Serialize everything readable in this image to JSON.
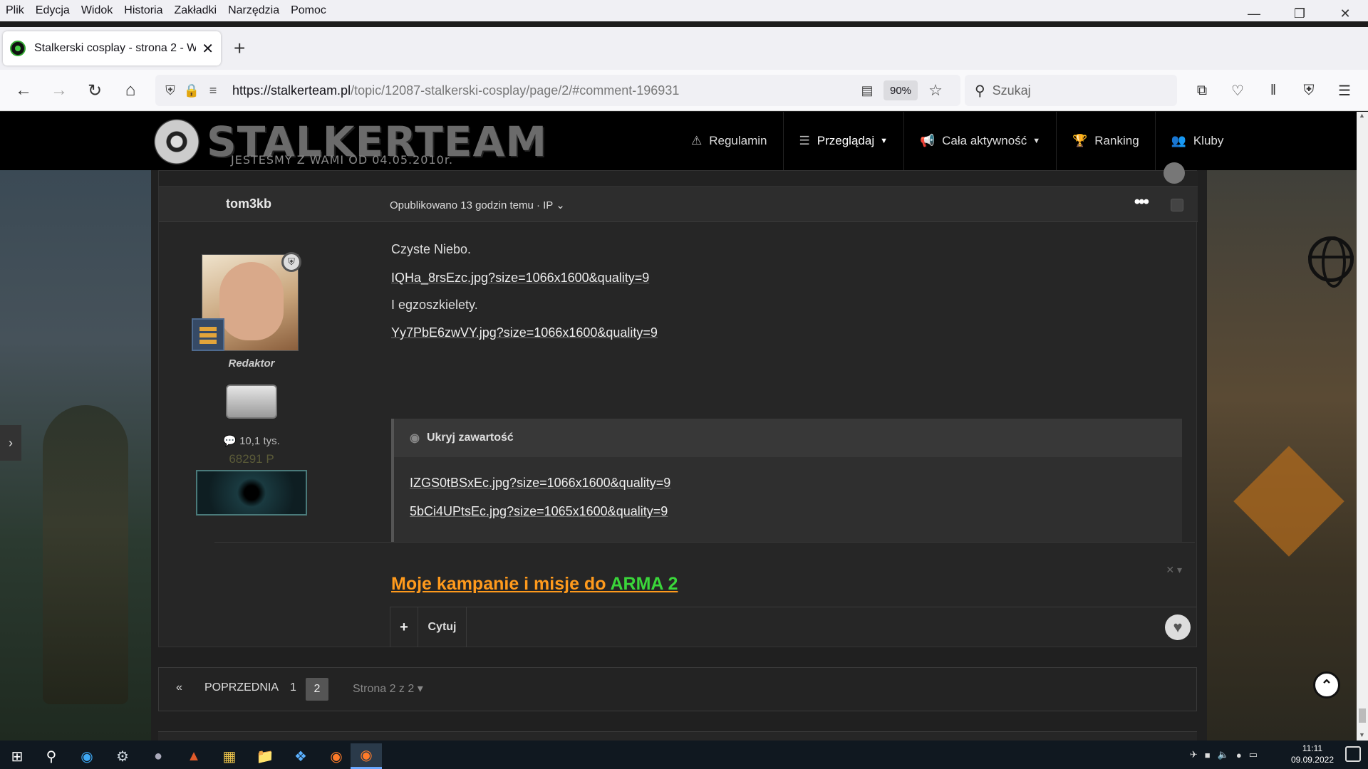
{
  "browser": {
    "menu": [
      "Plik",
      "Edycja",
      "Widok",
      "Historia",
      "Zakładki",
      "Narzędzia",
      "Pomoc"
    ],
    "tab_title": "Stalkerski cosplay - strona 2 - W",
    "url_host": "https://stalkerteam.pl",
    "url_path": "/topic/12087-stalkerski-cosplay/page/2/#comment-196931",
    "zoom": "90%",
    "search_placeholder": "Szukaj"
  },
  "site": {
    "logo_title": "STALKERTEAM",
    "logo_tagline": "JESTEŚMY Z WAMI OD 04.05.2010r.",
    "nav": [
      {
        "label": "Regulamin",
        "icon": "warning-icon"
      },
      {
        "label": "Przeglądaj",
        "icon": "list-icon",
        "dropdown": true
      },
      {
        "label": "Cała aktywność",
        "icon": "megaphone-icon",
        "dropdown": true
      },
      {
        "label": "Ranking",
        "icon": "trophy-icon"
      },
      {
        "label": "Kluby",
        "icon": "users-icon"
      }
    ]
  },
  "post": {
    "author": "tom3kb",
    "meta": "Opublikowano 13 godzin temu · IP",
    "role": "Redaktor",
    "posts_count": "10,1 tys.",
    "points": "68291 P",
    "lines": [
      {
        "text": "Czyste Niebo.",
        "link": false
      },
      {
        "text": "IQHa_8rsEzc.jpg?size=1066x1600&quality=9",
        "link": true
      },
      {
        "text": "I egzoszkielety.",
        "link": false
      },
      {
        "text": "Yy7PbE6zwVY.jpg?size=1066x1600&quality=9",
        "link": true
      }
    ],
    "spoiler": {
      "title": "Ukryj zawartość",
      "links": [
        "IZGS0tBSxEc.jpg?size=1066x1600&quality=9",
        "5bCi4UPtsEc.jpg?size=1065x1600&quality=9"
      ]
    },
    "signature_prefix": "Moje kampanie i misje do ",
    "signature_highlight": "ARMA 2",
    "quote_label": "Cytuj",
    "plus_label": "+"
  },
  "pagination": {
    "prev": "POPRZEDNIA",
    "pages": [
      "1",
      "2"
    ],
    "current": "2",
    "page_of": "Strona 2 z 2"
  },
  "taskbar": {
    "time": "11:11",
    "date": "09.09.2022"
  }
}
